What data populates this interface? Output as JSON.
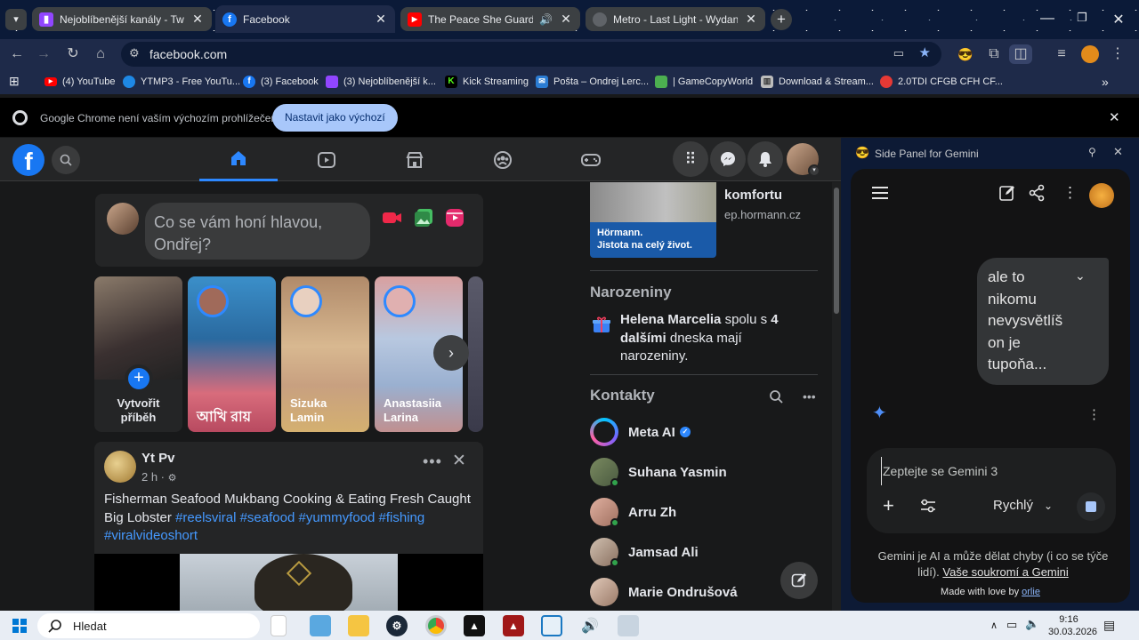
{
  "browser": {
    "tabs": [
      {
        "title": "Nejoblíbenější kanály - Twitch",
        "favicon_color": "#9146ff",
        "active": false
      },
      {
        "title": "Facebook",
        "favicon_color": "#1877f2",
        "active": true
      },
      {
        "title": "The Peace She Guards | Am",
        "favicon_color": "#ff0000",
        "active": false
      },
      {
        "title": "Metro - Last Light - Wydanie K",
        "favicon_color": "#5f6368",
        "active": false
      }
    ],
    "new_tab": "+",
    "url": "facebook.com",
    "bookmarks": [
      {
        "label": "(4) YouTube",
        "color": "#ff0000"
      },
      {
        "label": "YTMP3 - Free YouTu...",
        "color": "#1e88e5"
      },
      {
        "label": "(3) Facebook",
        "color": "#1877f2"
      },
      {
        "label": "(3) Nejoblíbenější k...",
        "color": "#9146ff"
      },
      {
        "label": "Kick Streaming",
        "color": "#53fc18"
      },
      {
        "label": "Pošta – Ondrej Lerc...",
        "color": "#2b7cd3"
      },
      {
        "label": "| GameCopyWorld",
        "color": "#4caf50"
      },
      {
        "label": "Download & Stream...",
        "color": "#bdbdbd"
      },
      {
        "label": "2.0TDI CFGB CFH CF...",
        "color": "#e53935"
      }
    ],
    "infobar": {
      "message": "Google Chrome není vaším výchozím prohlížečem",
      "button": "Nastavit jako výchozí"
    }
  },
  "facebook": {
    "composer": {
      "placeholder": "Co se vám honí hlavou, Ondřej?"
    },
    "stories": [
      {
        "name": "Vytvořit příběh"
      },
      {
        "name": "আখি রায়"
      },
      {
        "name": "Sizuka Lamin"
      },
      {
        "name": "Anastasiia Larina"
      }
    ],
    "post": {
      "author": "Yt Pv",
      "time": "2 h ·",
      "text": "Fisherman Seafood Mukbang Cooking & Eating Fresh Caught Big Lobster",
      "hashtags": "#reelsviral #seafood #yummyfood #fishing #viralvideoshort"
    },
    "ad": {
      "title": "komfortu",
      "domain": "ep.hormann.cz",
      "brand": "Hörmann.",
      "slogan": "Jistota na celý život."
    },
    "birthdays": {
      "heading": "Narozeniny",
      "name": "Helena Marcelia",
      "t1": " spolu s ",
      "count": "4 dalšími",
      "t2": " dneska mají narozeniny."
    },
    "contacts": {
      "heading": "Kontakty",
      "items": [
        {
          "name": "Meta AI",
          "online": false
        },
        {
          "name": "Suhana Yasmin",
          "online": true
        },
        {
          "name": "Arru Zh",
          "online": true
        },
        {
          "name": "Jamsad Ali",
          "online": true
        },
        {
          "name": "Marie Ondrušová",
          "online": false
        }
      ]
    }
  },
  "gemini": {
    "header": "Side Panel for Gemini",
    "user_message": "ale to nikomu nevysvětlíš on je tupoňa...",
    "input_placeholder": "Zeptejte se Gemini 3",
    "mode": "Rychlý",
    "disclaimer": "Gemini je AI a může dělat chyby (i co se týče lidí). ",
    "privacy_link": "Vaše soukromí a Gemini",
    "footer": "Made with love by ",
    "footer_link": "orlie"
  },
  "taskbar": {
    "search": "Hledat",
    "time": "9:16",
    "date": "30.03.2026"
  }
}
